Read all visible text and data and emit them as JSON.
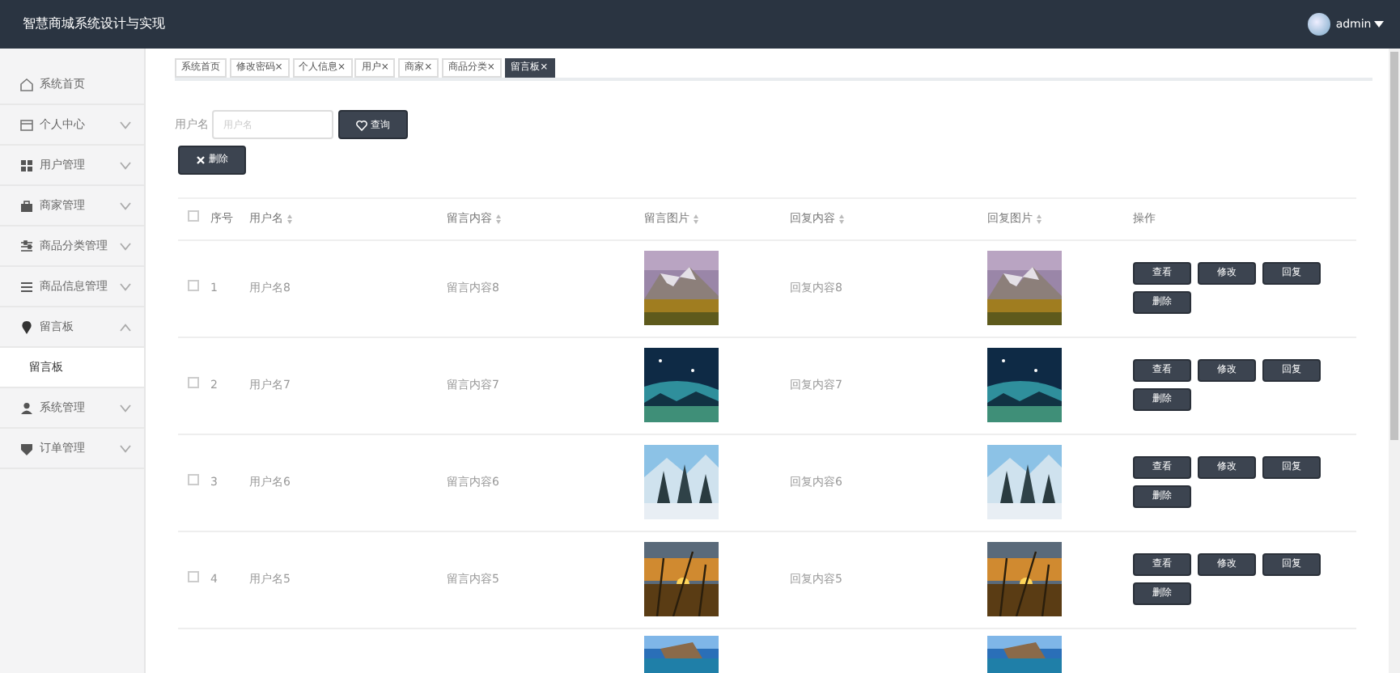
{
  "header": {
    "title": "智慧商城系统设计与实现",
    "user": "admin"
  },
  "sidebar": {
    "items": [
      {
        "kind": "link",
        "label": "系统首页"
      },
      {
        "kind": "group",
        "label": "个人中心",
        "expanded": false
      },
      {
        "kind": "group",
        "label": "用户管理",
        "expanded": false
      },
      {
        "kind": "group",
        "label": "商家管理",
        "expanded": false
      },
      {
        "kind": "group",
        "label": "商品分类管理",
        "expanded": false
      },
      {
        "kind": "group",
        "label": "商品信息管理",
        "expanded": false
      },
      {
        "kind": "group",
        "label": "留言板",
        "expanded": true,
        "children": [
          {
            "label": "留言板",
            "selected": true
          }
        ]
      },
      {
        "kind": "group",
        "label": "系统管理",
        "expanded": false
      },
      {
        "kind": "group",
        "label": "订单管理",
        "expanded": false
      }
    ]
  },
  "tabs": [
    {
      "label": "系统首页",
      "selected": false
    },
    {
      "label": "修改密码",
      "close": "×",
      "selected": false
    },
    {
      "label": "个人信息",
      "close": "×",
      "selected": false
    },
    {
      "label": "用户",
      "close": "×",
      "selected": false
    },
    {
      "label": "商家",
      "close": "×",
      "selected": false
    },
    {
      "label": "商品分类",
      "close": "×",
      "selected": false
    },
    {
      "label": "留言板",
      "close": "×",
      "selected": true
    }
  ],
  "search": {
    "label": "用户名",
    "placeholder": "用户名",
    "button": "查询"
  },
  "delete_button": "删除",
  "table": {
    "checked": false,
    "columns": [
      "序号",
      "用户名",
      "留言内容",
      "留言图片",
      "回复内容",
      "回复图片",
      "操作"
    ],
    "rows": [
      {
        "kind": "row",
        "checked": false,
        "index": "1",
        "username": "用户名8",
        "content": "留言内容8",
        "reply": "回复内容8",
        "actions": [
          "查看",
          "修改",
          "回复",
          "删除"
        ]
      },
      {
        "kind": "row",
        "checked": false,
        "index": "2",
        "username": "用户名7",
        "content": "留言内容7",
        "reply": "回复内容7",
        "actions": [
          "查看",
          "修改",
          "回复",
          "删除"
        ]
      },
      {
        "kind": "row",
        "checked": false,
        "index": "3",
        "username": "用户名6",
        "content": "留言内容6",
        "reply": "回复内容6",
        "actions": [
          "查看",
          "修改",
          "回复",
          "删除"
        ]
      },
      {
        "kind": "row",
        "checked": false,
        "index": "4",
        "username": "用户名5",
        "content": "留言内容5",
        "reply": "回复内容5",
        "actions": [
          "查看",
          "修改",
          "回复",
          "删除"
        ]
      },
      {
        "kind": "partial"
      }
    ]
  }
}
